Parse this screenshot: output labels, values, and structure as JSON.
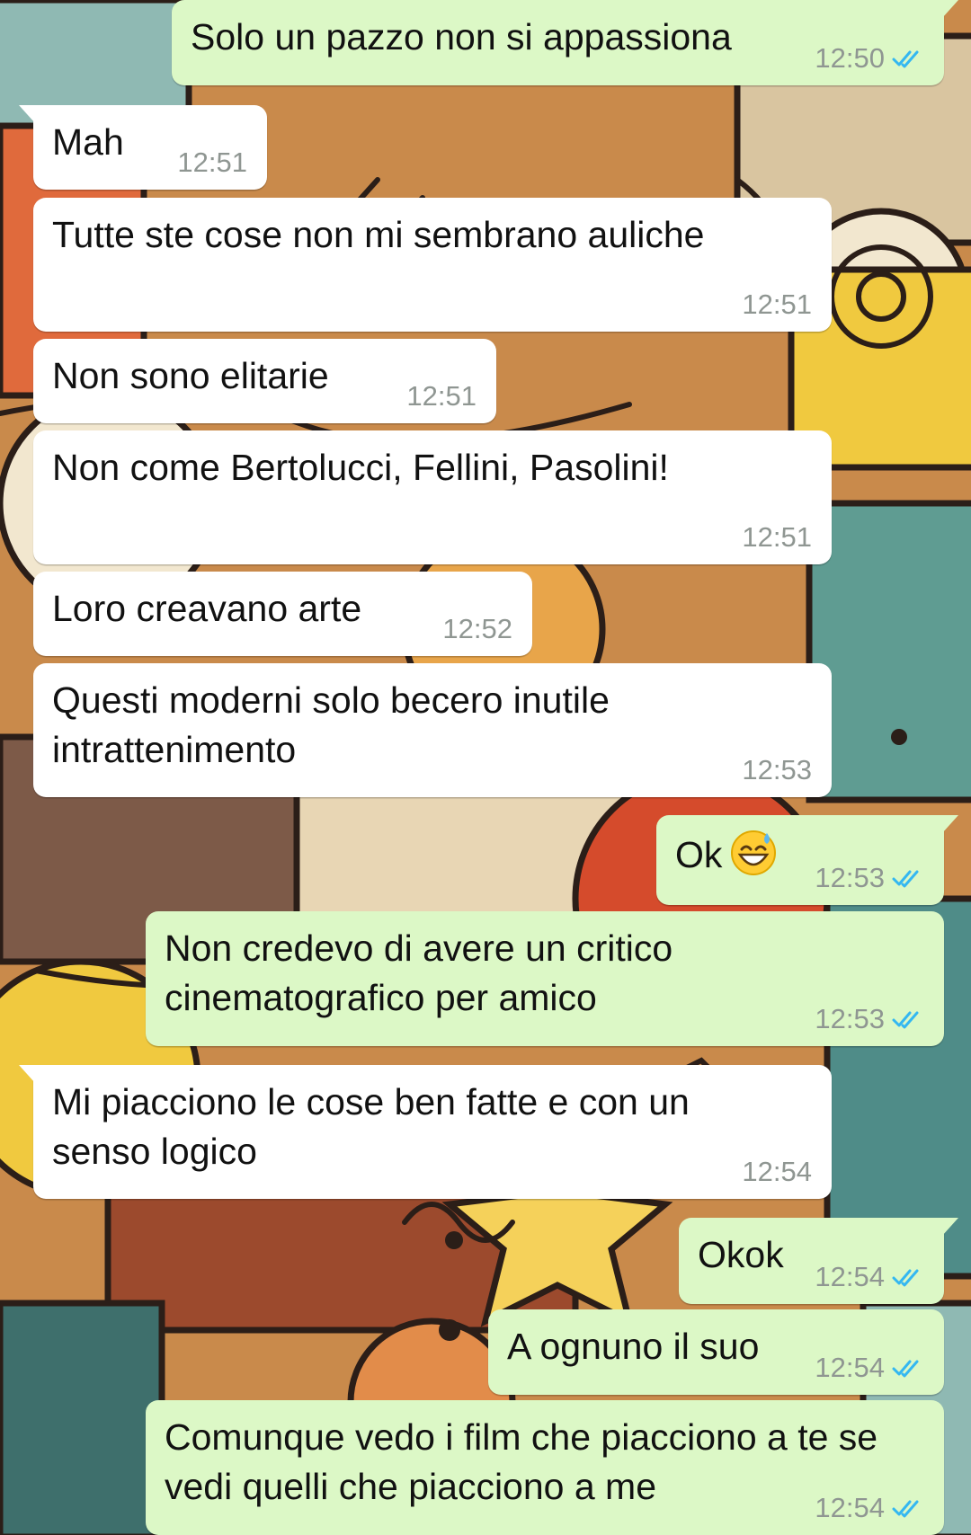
{
  "colors": {
    "incoming_bubble": "#ffffff",
    "outgoing_bubble": "#dcf8c6",
    "read_ticks": "#34b7f1",
    "timestamp": "#8f9692"
  },
  "messages": [
    {
      "text": "Solo un pazzo non si appassiona",
      "time": "12:50",
      "direction": "out",
      "status": "read"
    },
    {
      "text": "Mah",
      "time": "12:51",
      "direction": "in"
    },
    {
      "text": "Tutte ste cose non mi sembrano auliche",
      "time": "12:51",
      "direction": "in"
    },
    {
      "text": "Non sono elitarie",
      "time": "12:51",
      "direction": "in"
    },
    {
      "text": "Non come Bertolucci, Fellini, Pasolini!",
      "time": "12:51",
      "direction": "in"
    },
    {
      "text": "Loro creavano arte",
      "time": "12:52",
      "direction": "in"
    },
    {
      "text": "Questi moderni solo becero inutile intrattenimento",
      "time": "12:53",
      "direction": "in"
    },
    {
      "text": "Ok",
      "emoji": "grinning-face-with-sweat",
      "time": "12:53",
      "direction": "out",
      "status": "read"
    },
    {
      "text": "Non credevo di avere un critico cinematografico per amico",
      "time": "12:53",
      "direction": "out",
      "status": "read"
    },
    {
      "text": "Mi piacciono le cose ben fatte e con un senso logico",
      "time": "12:54",
      "direction": "in"
    },
    {
      "text": "Okok",
      "time": "12:54",
      "direction": "out",
      "status": "read"
    },
    {
      "text": "A ognuno il suo",
      "time": "12:54",
      "direction": "out",
      "status": "read"
    },
    {
      "text": "Comunque vedo i film che piacciono a te se vedi quelli che piacciono a me",
      "time": "12:54",
      "direction": "out",
      "status": "read"
    }
  ]
}
